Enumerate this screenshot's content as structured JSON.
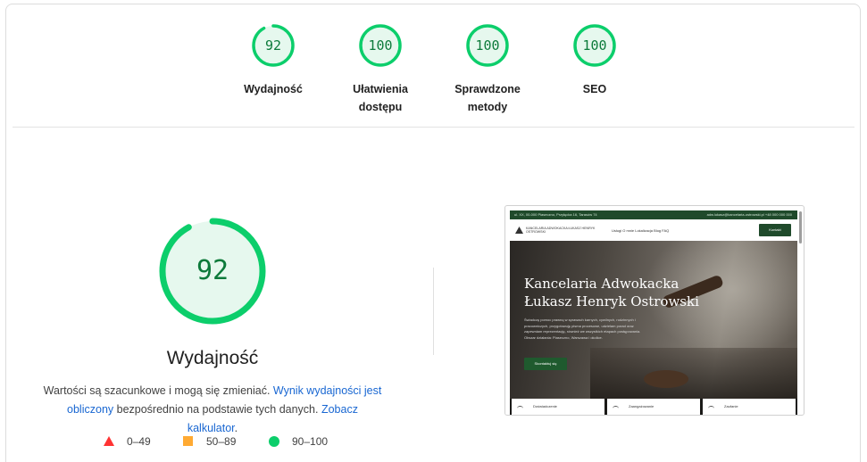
{
  "categories": [
    {
      "score": "92",
      "label_line1": "Wydajność",
      "label_line2": "",
      "fraction": 0.92
    },
    {
      "score": "100",
      "label_line1": "Ułatwienia",
      "label_line2": "dostępu",
      "fraction": 1.0
    },
    {
      "score": "100",
      "label_line1": "Sprawdzone",
      "label_line2": "metody",
      "fraction": 1.0
    },
    {
      "score": "100",
      "label_line1": "SEO",
      "label_line2": "",
      "fraction": 1.0
    }
  ],
  "performance": {
    "score": "92",
    "fraction": 0.92,
    "title": "Wydajność",
    "desc_part1": "Wartości są szacunkowe i mogą się zmieniać. ",
    "desc_link1": "Wynik wydajności jest obliczony",
    "desc_part2": " bezpośrednio na podstawie tych danych. ",
    "desc_link2": "Zobacz kalkulator",
    "desc_part3": "."
  },
  "legend": {
    "fail": "0–49",
    "average": "50–89",
    "pass": "90–100"
  },
  "colors": {
    "pass": "#0cce6b",
    "pass_bg": "#e6f8ee",
    "pass_text": "#0c7a3a",
    "average": "#ffaa33",
    "fail": "#ff3333",
    "link": "#1967d2"
  },
  "thumbnail": {
    "topbar_left": "ul. XX, 00-000 Piaseczno, Przyłęcka 16, Tarasów 74",
    "topbar_right": "adw.lukasz@kancelaria-ostrowski.pl   +48 000 000 000",
    "brand": "KANCELARIA ADWOKACKA ŁUKASZ HENRYK OSTROWSKI",
    "menu": "Usługi    O mnie    Lokalizacja    Blog    FAQ",
    "nav_button": "Kontakt",
    "hero_title_line1": "Kancelaria Adwokacka",
    "hero_title_line2": "Łukasz Henryk Ostrowski",
    "hero_text": "Świadczę pomoc prawną w sprawach karnych, cywilnych, rodzinnych i pracowniczych, przygotowuję pisma procesowe, udzielam porad oraz zapewniam reprezentację, również we wszystkich etapach postępowania. Obszar działania: Piaseczno, Warszawa i okolice.",
    "hero_button": "Skontaktuj się",
    "card1": "Doświadczenie",
    "card2": "Zaangażowanie",
    "card3": "Zaufanie"
  }
}
